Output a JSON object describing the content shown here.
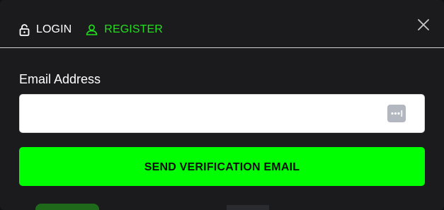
{
  "tabs": {
    "login": {
      "label": "LOGIN",
      "icon": "lock-icon"
    },
    "register": {
      "label": "REGISTER",
      "icon": "user-icon"
    }
  },
  "close": {
    "icon": "close-icon"
  },
  "form": {
    "email_label": "Email Address",
    "email_value": "",
    "password_manager_icon": "password-manager-icon"
  },
  "actions": {
    "send_label": "SEND VERIFICATION EMAIL"
  },
  "colors": {
    "background": "#1b1b1d",
    "accent": "#00ff00",
    "register_tab": "#22e01c",
    "divider": "#cfd0d4"
  }
}
